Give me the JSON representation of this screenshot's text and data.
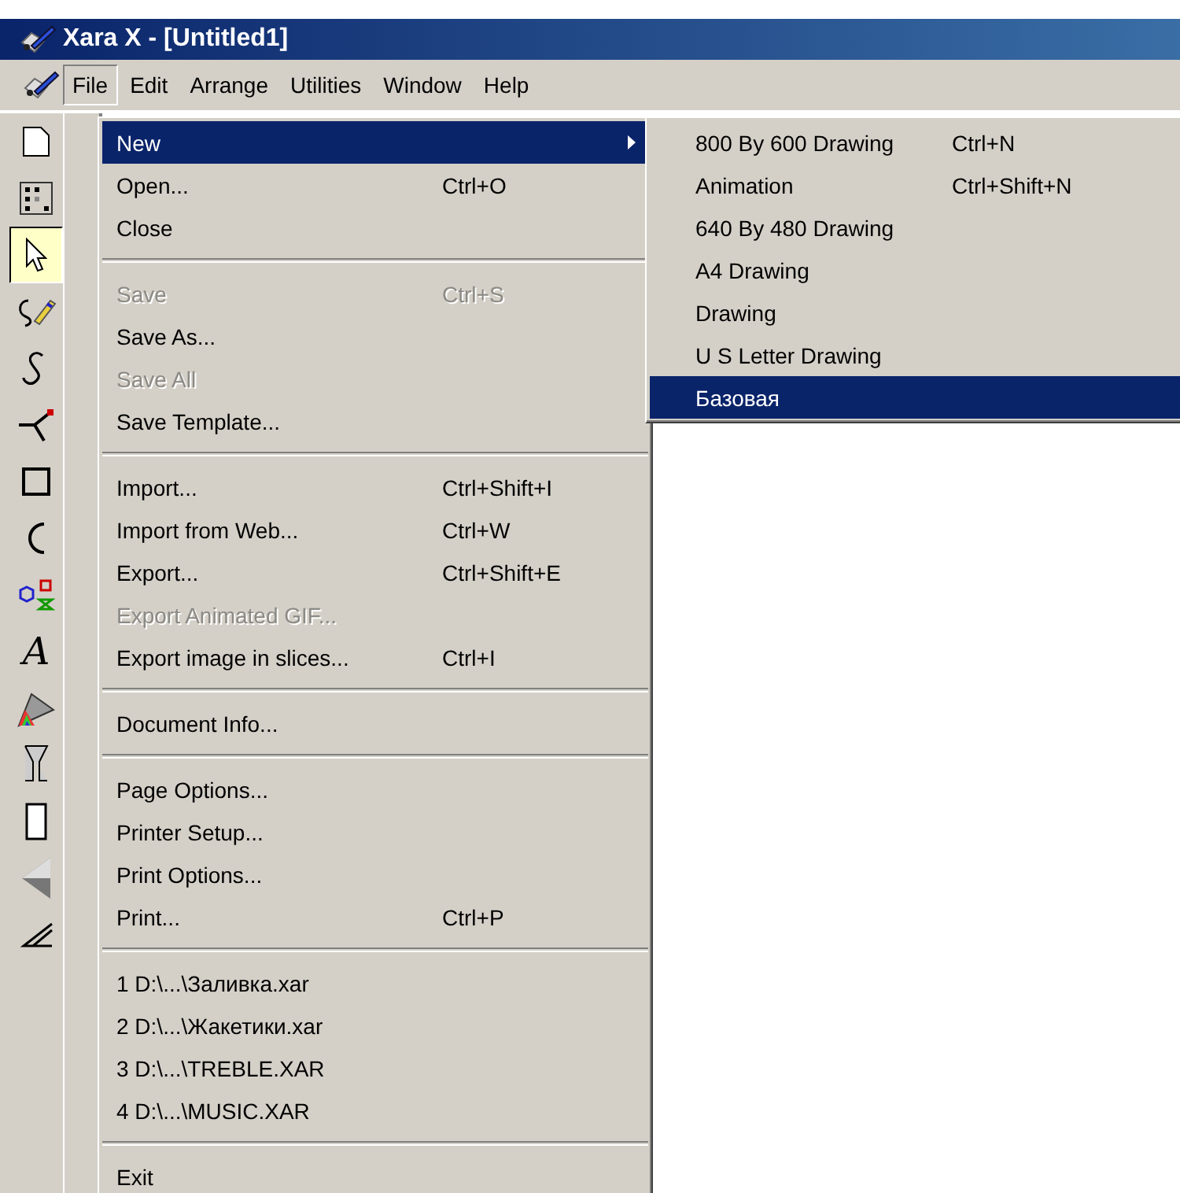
{
  "window": {
    "title": "Xara X - [Untitled1]"
  },
  "menubar": [
    {
      "label": "File",
      "selected": true
    },
    {
      "label": "Edit",
      "selected": false
    },
    {
      "label": "Arrange",
      "selected": false
    },
    {
      "label": "Utilities",
      "selected": false
    },
    {
      "label": "Window",
      "selected": false
    },
    {
      "label": "Help",
      "selected": false
    }
  ],
  "toolbar": [
    {
      "kind": "page",
      "selected": false
    },
    {
      "kind": "grid",
      "selected": false
    },
    {
      "kind": "selector",
      "selected": true
    },
    {
      "kind": "freehand",
      "selected": false
    },
    {
      "kind": "curve",
      "selected": false
    },
    {
      "kind": "pen",
      "selected": false
    },
    {
      "kind": "rectangle",
      "selected": false
    },
    {
      "kind": "ellipse",
      "selected": false
    },
    {
      "kind": "shapes",
      "selected": false
    },
    {
      "kind": "text",
      "glyph": "A",
      "selected": false
    },
    {
      "kind": "fill",
      "selected": false
    },
    {
      "kind": "glass",
      "selected": false
    },
    {
      "kind": "mould",
      "selected": false
    },
    {
      "kind": "bevel",
      "selected": false
    },
    {
      "kind": "contour",
      "selected": false
    }
  ],
  "file_menu": [
    {
      "kind": "item",
      "label": "New",
      "submenu": true,
      "selected": true,
      "disabled": false
    },
    {
      "kind": "item",
      "label": "Open...",
      "shortcut": "Ctrl+O",
      "selected": false,
      "disabled": false
    },
    {
      "kind": "item",
      "label": "Close",
      "selected": false,
      "disabled": false
    },
    {
      "kind": "separator"
    },
    {
      "kind": "item",
      "label": "Save",
      "shortcut": "Ctrl+S",
      "selected": false,
      "disabled": true
    },
    {
      "kind": "item",
      "label": "Save As...",
      "selected": false,
      "disabled": false
    },
    {
      "kind": "item",
      "label": "Save All",
      "selected": false,
      "disabled": true
    },
    {
      "kind": "item",
      "label": "Save Template...",
      "selected": false,
      "disabled": false
    },
    {
      "kind": "separator"
    },
    {
      "kind": "item",
      "label": "Import...",
      "shortcut": "Ctrl+Shift+I",
      "selected": false,
      "disabled": false
    },
    {
      "kind": "item",
      "label": "Import from Web...",
      "shortcut": "Ctrl+W",
      "selected": false,
      "disabled": false
    },
    {
      "kind": "item",
      "label": "Export...",
      "shortcut": "Ctrl+Shift+E",
      "selected": false,
      "disabled": false
    },
    {
      "kind": "item",
      "label": "Export Animated GIF...",
      "selected": false,
      "disabled": true
    },
    {
      "kind": "item",
      "label": "Export image in slices...",
      "shortcut": "Ctrl+I",
      "selected": false,
      "disabled": false
    },
    {
      "kind": "separator"
    },
    {
      "kind": "item",
      "label": "Document Info...",
      "selected": false,
      "disabled": false
    },
    {
      "kind": "separator"
    },
    {
      "kind": "item",
      "label": "Page Options...",
      "selected": false,
      "disabled": false
    },
    {
      "kind": "item",
      "label": "Printer Setup...",
      "selected": false,
      "disabled": false
    },
    {
      "kind": "item",
      "label": "Print Options...",
      "selected": false,
      "disabled": false
    },
    {
      "kind": "item",
      "label": "Print...",
      "shortcut": "Ctrl+P",
      "selected": false,
      "disabled": false
    },
    {
      "kind": "separator"
    },
    {
      "kind": "item",
      "label": "1 D:\\...\\Заливка.xar",
      "selected": false,
      "disabled": false
    },
    {
      "kind": "item",
      "label": "2 D:\\...\\Жакетики.xar",
      "selected": false,
      "disabled": false
    },
    {
      "kind": "item",
      "label": "3 D:\\...\\TREBLE.XAR",
      "selected": false,
      "disabled": false
    },
    {
      "kind": "item",
      "label": "4 D:\\...\\MUSIC.XAR",
      "selected": false,
      "disabled": false
    },
    {
      "kind": "separator"
    },
    {
      "kind": "item",
      "label": "Exit",
      "selected": false,
      "disabled": false
    }
  ],
  "new_submenu": [
    {
      "label": "800 By 600 Drawing",
      "shortcut": "Ctrl+N",
      "selected": false
    },
    {
      "label": "Animation",
      "shortcut": "Ctrl+Shift+N",
      "selected": false
    },
    {
      "label": "640 By 480 Drawing",
      "selected": false
    },
    {
      "label": "A4 Drawing",
      "selected": false
    },
    {
      "label": "Drawing",
      "selected": false
    },
    {
      "label": "U S Letter Drawing",
      "selected": false
    },
    {
      "label": "Базовая",
      "selected": true
    }
  ]
}
